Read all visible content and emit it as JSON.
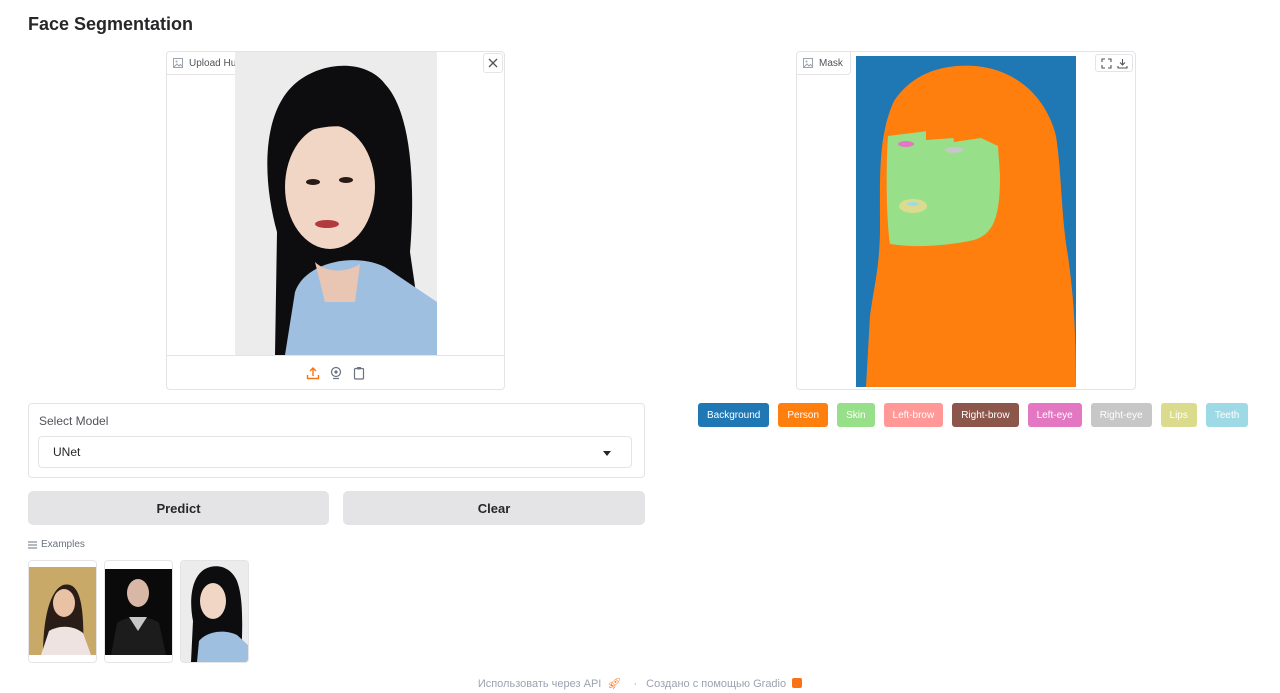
{
  "app": {
    "title": "Face Segmentation"
  },
  "upload": {
    "label": "Upload Human Image",
    "icon": "image-icon"
  },
  "mask": {
    "label": "Mask",
    "icon": "image-icon"
  },
  "legend": [
    {
      "label": "Background",
      "color": "#1f77b4"
    },
    {
      "label": "Person",
      "color": "#ff7f0e"
    },
    {
      "label": "Skin",
      "color": "#98df8a"
    },
    {
      "label": "Left-brow",
      "color": "#ff9896"
    },
    {
      "label": "Right-brow",
      "color": "#8c564b"
    },
    {
      "label": "Left-eye",
      "color": "#e377c2"
    },
    {
      "label": "Right-eye",
      "color": "#c7c7c7"
    },
    {
      "label": "Lips",
      "color": "#dbdb8d"
    },
    {
      "label": "Teeth",
      "color": "#9edae5"
    }
  ],
  "model": {
    "label": "Select Model",
    "value": "UNet"
  },
  "buttons": {
    "predict": "Predict",
    "clear": "Clear"
  },
  "examples": {
    "label": "Examples"
  },
  "footer": {
    "api": "Использовать через API",
    "sep": "·",
    "built": "Создано с помощью Gradio"
  }
}
